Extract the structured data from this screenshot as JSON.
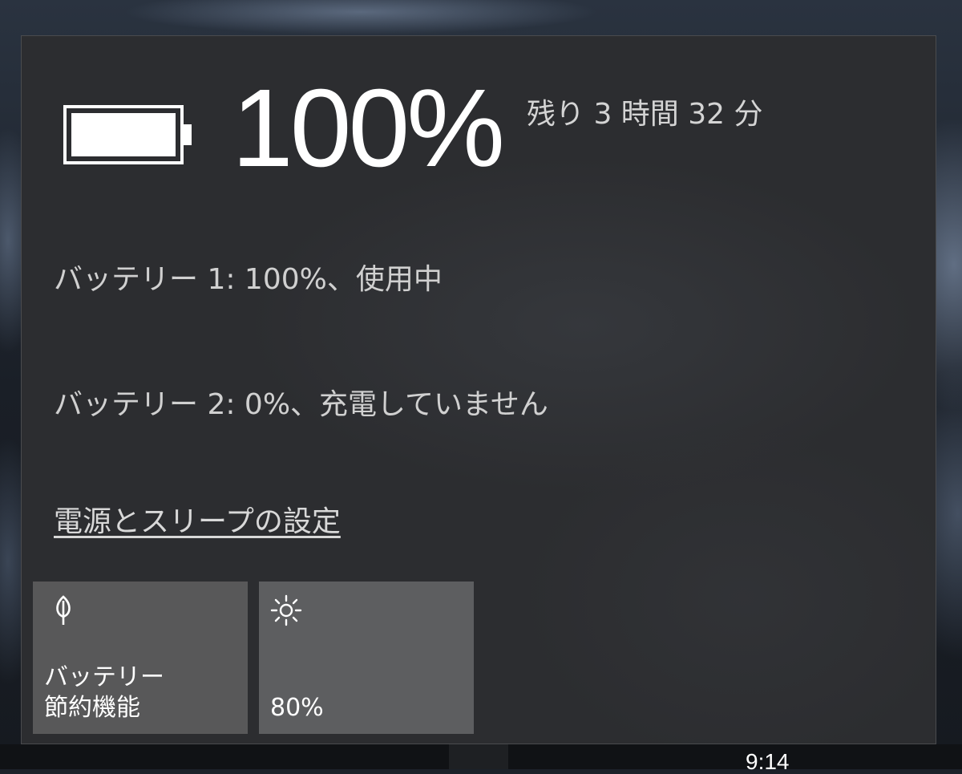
{
  "battery": {
    "overall_percent": "100%",
    "level": 1.0,
    "time_remaining": "残り 3 時間 32 分",
    "packs": [
      {
        "status": "バッテリー 1: 100%、使用中"
      },
      {
        "status": "バッテリー 2: 0%、充電していません"
      }
    ]
  },
  "settings_link": "電源とスリープの設定",
  "quick_actions": {
    "battery_saver": {
      "icon": "leaf-icon",
      "label_line1": "バッテリー",
      "label_line2": "節約機能"
    },
    "brightness": {
      "icon": "sun-icon",
      "label": "80%"
    }
  },
  "taskbar": {
    "clock_time": "9:14"
  },
  "colors": {
    "flyout_bg": "#2c2d30",
    "tile_bg": "#5b5c5e",
    "text_primary": "#ffffff",
    "text_secondary": "#d0d0d0"
  }
}
